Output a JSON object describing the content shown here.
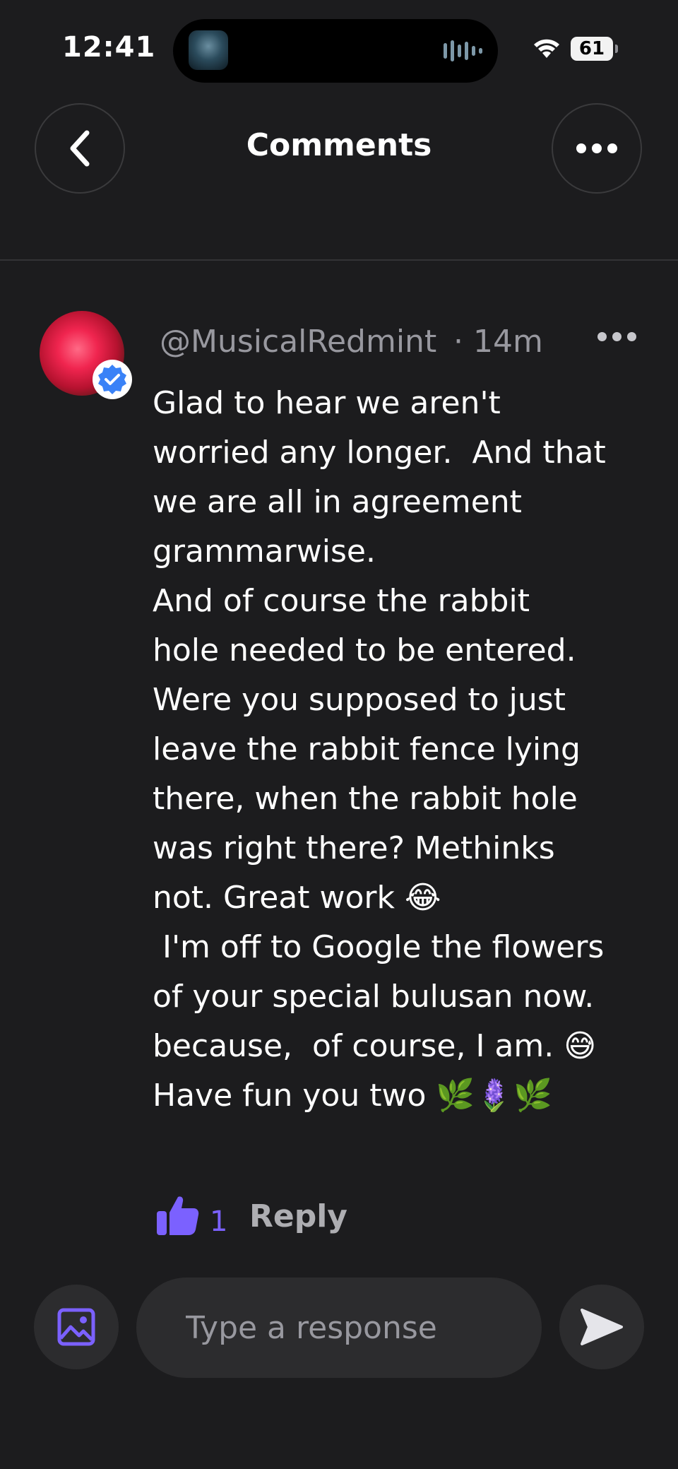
{
  "status_bar": {
    "time": "12:41",
    "battery": "61"
  },
  "header": {
    "title": "Comments",
    "back_icon": "chevron-left-icon",
    "more_icon": "ellipsis-icon"
  },
  "comment": {
    "username": "@MusicalRedmint",
    "timestamp": "· 14m",
    "verified": true,
    "lines": [
      "Glad to hear we aren't",
      "worried any longer.  And that",
      "we are all in agreement",
      "grammarwise.",
      "And of course the rabbit",
      "hole needed to be entered.",
      "Were you supposed to just",
      "leave the rabbit fence lying",
      "there, when the rabbit hole",
      "was right there? Methinks",
      "not. Great work 😂",
      " I'm off to Google the flowers",
      "of your special bulusan now.",
      "because,  of course, I am. 😅",
      "Have fun you two 🌿🪻🌿"
    ],
    "like_count": "1",
    "reply_label": "Reply"
  },
  "composer": {
    "placeholder": "Type a response",
    "image_icon": "image-icon",
    "send_icon": "send-icon"
  },
  "colors": {
    "background": "#1c1c1e",
    "accent": "#7b61ff",
    "verified": "#3a82f7",
    "muted_text": "#98989f"
  }
}
